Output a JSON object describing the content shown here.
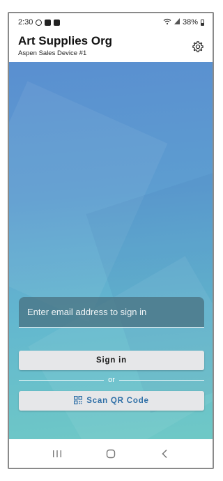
{
  "status_bar": {
    "time": "2:30",
    "battery_text": "38%",
    "icons": [
      "whatsapp-icon",
      "image-icon",
      "notification-icon",
      "wifi-icon",
      "signal-icon",
      "battery-icon"
    ]
  },
  "header": {
    "org_name": "Art Supplies Org",
    "device_name": "Aspen Sales Device #1",
    "settings_icon": "gear-icon"
  },
  "login": {
    "email_placeholder": "Enter email address to sign in",
    "email_value": "",
    "sign_in_label": "Sign in",
    "divider_text": "or",
    "scan_label": "Scan QR Code",
    "scan_icon": "qr-code-icon"
  },
  "nav_bar": {
    "icons": [
      "recents-icon",
      "home-icon",
      "back-icon"
    ]
  },
  "colors": {
    "accent": "#2f6fa6",
    "button_bg": "#e6e7e9",
    "field_bg": "#466e7d",
    "gradient_top": "#5a8fd0",
    "gradient_bottom": "#6fc9c6"
  }
}
